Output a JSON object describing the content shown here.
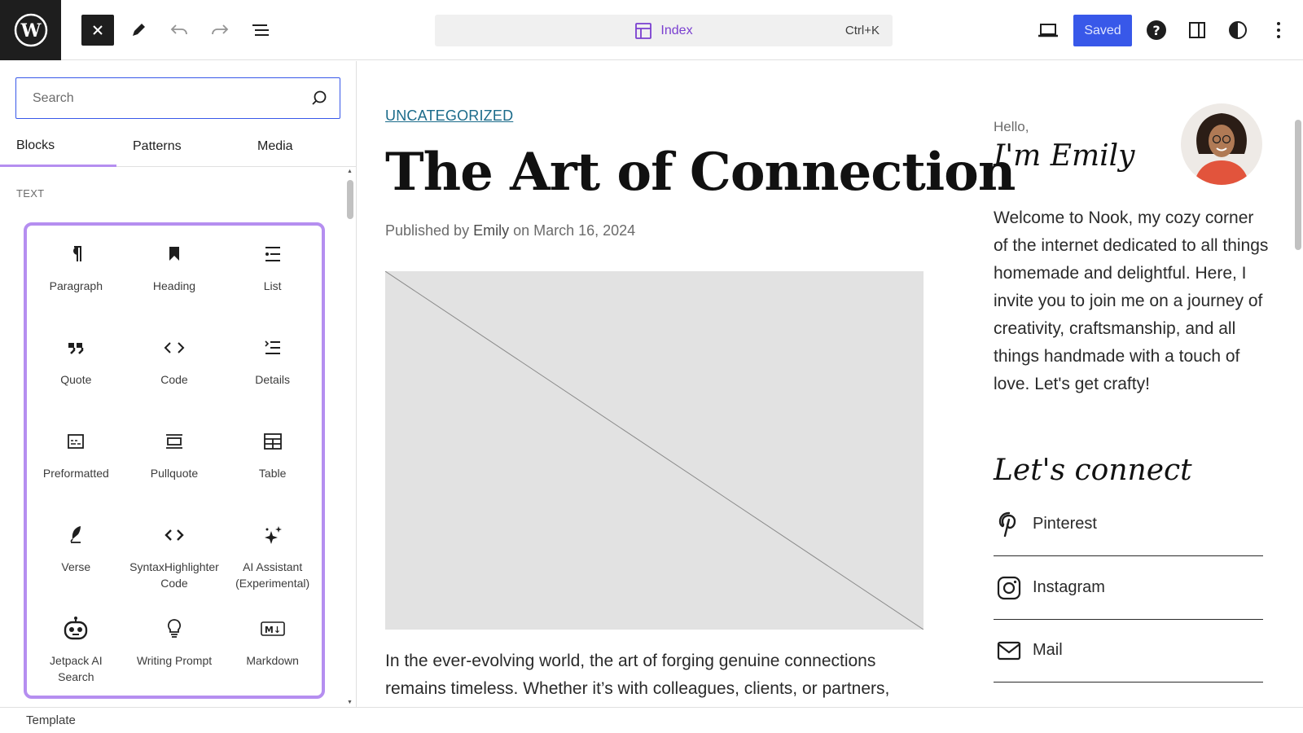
{
  "toolbar": {
    "template_name": "Index",
    "shortcut": "Ctrl+K",
    "saved_label": "Saved"
  },
  "inserter": {
    "search_placeholder": "Search",
    "tabs": [
      "Blocks",
      "Patterns",
      "Media"
    ],
    "active_tab": "Blocks",
    "section_label": "TEXT",
    "blocks": [
      {
        "label": "Paragraph",
        "icon": "paragraph-icon"
      },
      {
        "label": "Heading",
        "icon": "bookmark-icon"
      },
      {
        "label": "List",
        "icon": "list-icon"
      },
      {
        "label": "Quote",
        "icon": "quote-icon"
      },
      {
        "label": "Code",
        "icon": "code-icon"
      },
      {
        "label": "Details",
        "icon": "details-icon"
      },
      {
        "label": "Preformatted",
        "icon": "preformatted-icon"
      },
      {
        "label": "Pullquote",
        "icon": "pullquote-icon"
      },
      {
        "label": "Table",
        "icon": "table-icon"
      },
      {
        "label": "Verse",
        "icon": "feather-icon"
      },
      {
        "label": "SyntaxHighlighter Code",
        "icon": "code-brackets-icon"
      },
      {
        "label": "AI Assistant (Experimental)",
        "icon": "sparkle-icon"
      },
      {
        "label": "Jetpack AI Search",
        "icon": "robot-icon"
      },
      {
        "label": "Writing Prompt",
        "icon": "lightbulb-icon"
      },
      {
        "label": "Markdown",
        "icon": "markdown-icon"
      }
    ],
    "accent_color": "#b58ef0"
  },
  "footer": {
    "label": "Template"
  },
  "post": {
    "category": "UNCATEGORIZED",
    "title": "The Art of Connection",
    "meta_prefix": "Published by ",
    "meta_author": "Emily",
    "meta_middle": " on ",
    "meta_date": "March 16, 2024",
    "body": "In the ever-evolving world, the art of forging genuine connections remains timeless. Whether it’s with colleagues, clients, or partners,"
  },
  "sidebar": {
    "hello": "Hello,",
    "name": "I'm Emily",
    "welcome": "Welcome to Nook, my cozy corner of the internet dedicated to all things homemade and delightful. Here, I invite you to join me on a journey of creativity, craftsmanship, and all things handmade with a touch of love. Let's get crafty!",
    "connect_heading": "Let's connect",
    "social": [
      {
        "label": "Pinterest",
        "icon": "pinterest-icon"
      },
      {
        "label": "Instagram",
        "icon": "instagram-icon"
      },
      {
        "label": "Mail",
        "icon": "mail-icon"
      }
    ]
  },
  "colors": {
    "primary_button": "#3858e9",
    "template_link": "#7a3fd0",
    "category_link": "#1b6b8a"
  }
}
